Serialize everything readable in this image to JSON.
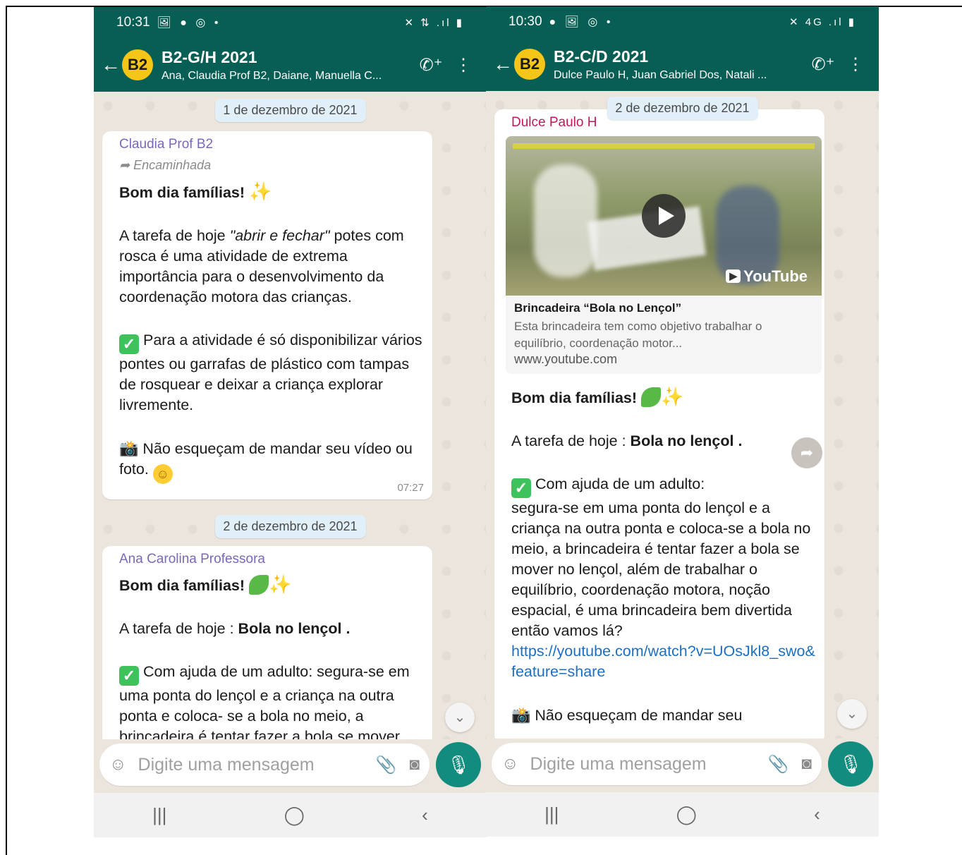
{
  "left": {
    "status": {
      "time": "10:31",
      "icons": "🖼 ● ◎ •",
      "right": "✕ ⇅ .ıl ▮"
    },
    "header": {
      "back": "←",
      "avatar": "B2",
      "title": "B2-G/H 2021",
      "subtitle": "Ana, Claudia Prof B2, Daiane, Manuella C...",
      "call_icon": "✆⁺",
      "menu_icon": "⋮"
    },
    "date_chip_1": "1 de dezembro de 2021",
    "msg1": {
      "sender": "Claudia Prof B2",
      "forwarded": "Encaminhada",
      "greeting": "Bom dia famílias!",
      "p1_a": "A tarefa de hoje ",
      "p1_em": "\"abrir e fechar\"",
      "p1_b": " potes com rosca é uma atividade de extrema importância para o desenvolvimento da coordenação motora das crianças.",
      "p2": "Para a atividade é só disponibilizar vários pontes ou garrafas de plástico com tampas de rosquear e deixar a criança explorar livremente.",
      "p3": "Não esqueçam de mandar seu vídeo ou foto.",
      "time": "07:27"
    },
    "date_chip_2": "2 de dezembro de 2021",
    "msg2": {
      "sender": "Ana Carolina Professora",
      "greeting": "Bom dia famílias!",
      "p1_a": "A tarefa de hoje : ",
      "p1_b": "Bola no lençol .",
      "p2": "Com ajuda de um adulto: segura-se em uma ponta do lençol  e a criança na outra ponta e coloca- se a bola no meio, a brincadeira é tentar fazer a bola  se mover"
    },
    "input_placeholder": "Digite uma mensagem"
  },
  "right": {
    "status": {
      "time": "10:30",
      "icons": "● 🖼 ◎ •",
      "right": "✕ 4G .ıl ▮"
    },
    "header": {
      "back": "←",
      "avatar": "B2",
      "title": "B2-C/D 2021",
      "subtitle": "Dulce Paulo H, Juan Gabriel Dos, Natali ...",
      "call_icon": "✆⁺",
      "menu_icon": "⋮"
    },
    "date_chip": "2 de dezembro de 2021",
    "msg": {
      "sender": "Dulce Paulo H",
      "preview_brand": "YouTube",
      "preview_title": "Brincadeira “Bola no Lençol”",
      "preview_desc": "Esta brincadeira tem como objetivo trabalhar o equilíbrio, coordenação motor...",
      "preview_domain": "www.youtube.com",
      "greeting": "Bom dia famílias!",
      "p1_a": "A tarefa de hoje : ",
      "p1_b": "Bola no lençol .",
      "p2_a": "Com ajuda de um adulto:",
      "p2_b": "segura-se em uma ponta do lençol e a criança na outra ponta e coloca-se a bola no meio, a brincadeira é tentar fazer a bola  se mover no lençol, além de trabalhar o equilíbrio, coordenação motora, noção espacial, é uma brincadeira bem divertida então vamos lá?",
      "link": "https://youtube.com/watch?v=UOsJkl8_swo&feature=share",
      "p3": "Não esqueçam de mandar seu"
    },
    "input_placeholder": "Digite uma mensagem"
  },
  "nav": {
    "recents": "|||",
    "home": "◯",
    "back": "‹"
  },
  "colors": {
    "header": "#075e54",
    "mic": "#128c7e",
    "chat_bg": "#ece5dd",
    "claudia_name": "#7b68b8",
    "ana_name": "#7b68b8",
    "dulce_name": "#c2185b",
    "link": "#1d6fc2"
  }
}
